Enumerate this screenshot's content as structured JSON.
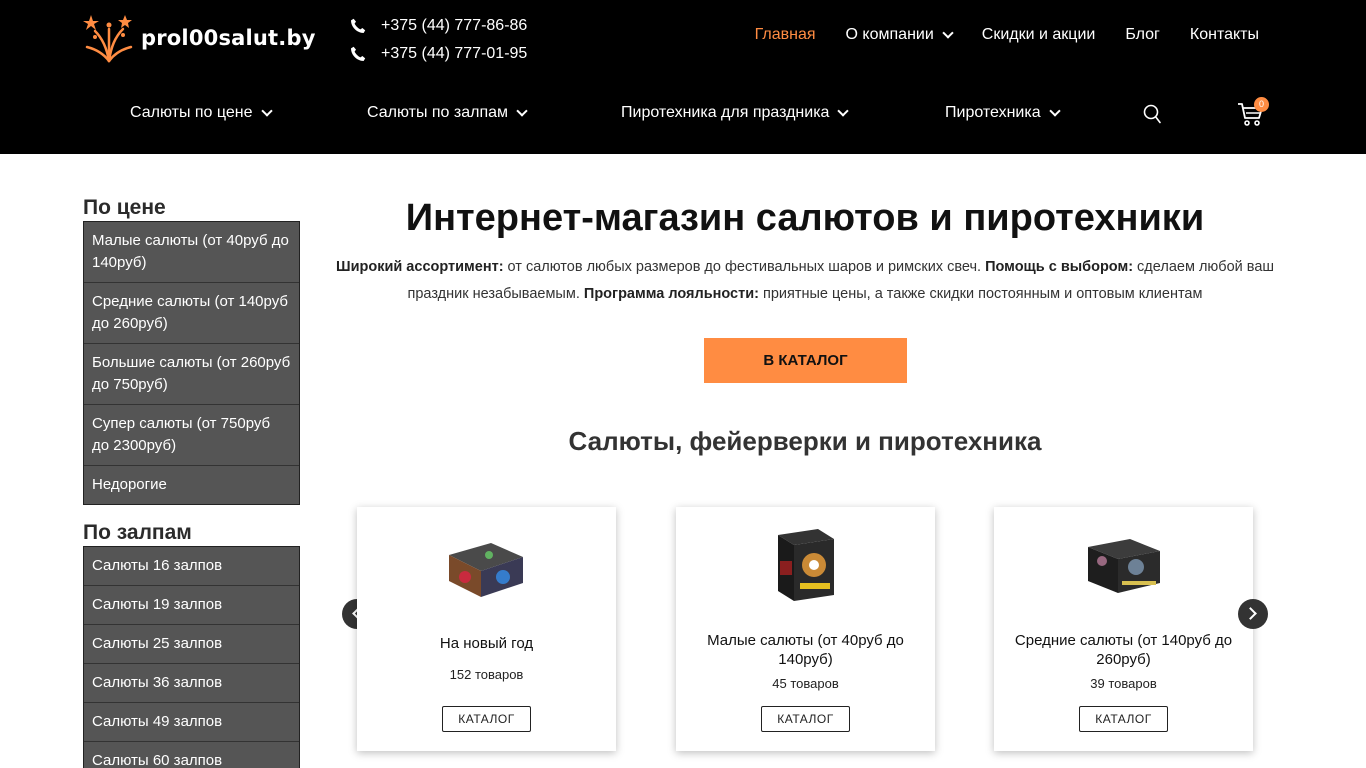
{
  "header": {
    "logo_text": "prol00salut.by",
    "phones": [
      "+375 (44) 777-86-86",
      "+375 (44) 777-01-95"
    ],
    "topnav": [
      {
        "label": "Главная",
        "active": true
      },
      {
        "label": "О компании",
        "dropdown": true
      },
      {
        "label": "Скидки и акции"
      },
      {
        "label": "Блог"
      },
      {
        "label": "Контакты"
      }
    ],
    "mainnav": [
      {
        "label": "Салюты по цене"
      },
      {
        "label": "Салюты по залпам"
      },
      {
        "label": "Пиротехника для праздника"
      },
      {
        "label": "Пиротехника"
      }
    ],
    "cart_count": "0",
    "accent_color": "#ff8c42"
  },
  "sidebar": {
    "price_title": "По цене",
    "price_items": [
      "Малые салюты (от 40руб до 140руб)",
      "Средние салюты (от 140руб до 260руб)",
      "Большие салюты (от 260руб до 750руб)",
      "Супер салюты (от 750руб до 2300руб)",
      "Недорогие"
    ],
    "shots_title": "По залпам",
    "shots_items": [
      "Салюты 16 залпов",
      "Салюты 19 залпов",
      "Салюты 25 залпов",
      "Салюты 36 залпов",
      "Салюты 49 залпов",
      "Салюты 60 залпов"
    ]
  },
  "main": {
    "title": "Интернет-магазин салютов и пиротехники",
    "desc": {
      "b1": "Широкий ассортимент:",
      "t1": " от салютов любых размеров до фестивальных шаров и римских свеч. ",
      "b2": "Помощь с выбором:",
      "t2": " сделаем любой ваш праздник незабываемым. ",
      "b3": "Программа лояльности:",
      "t3": " приятные цены, а также скидки постоянным и оптовым клиентам"
    },
    "cta_label": "В КАТАЛОГ",
    "section_title": "Салюты, фейерверки и пиротехника",
    "cards": [
      {
        "name": "На новый год",
        "count": "152 товаров",
        "button": "КАТАЛОГ"
      },
      {
        "name": "Малые салюты (от 40руб до 140руб)",
        "count": "45 товаров",
        "button": "КАТАЛОГ"
      },
      {
        "name": "Средние салюты (от 140руб до 260руб)",
        "count": "39 товаров",
        "button": "КАТАЛОГ"
      }
    ]
  }
}
